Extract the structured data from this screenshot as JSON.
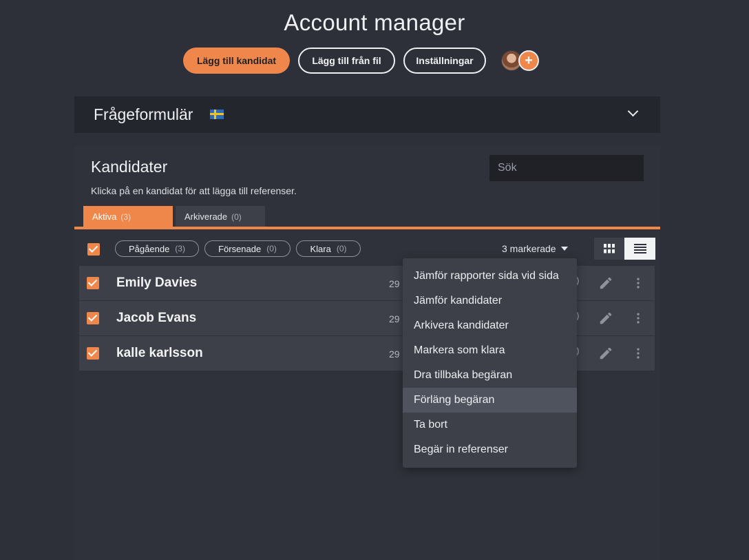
{
  "header": {
    "title": "Account manager",
    "buttons": {
      "add_candidate": "Lägg till kandidat",
      "add_from_file": "Lägg till från fil",
      "settings": "Inställningar"
    },
    "avatar_add_symbol": "+"
  },
  "form_panel": {
    "title": "Frågeformulär",
    "flag": "swedish-flag",
    "expanded": false
  },
  "candidates": {
    "title": "Kandidater",
    "subtitle": "Klicka på en kandidat för att lägga till referenser.",
    "search_placeholder": "Sök",
    "tabs": [
      {
        "label": "Aktiva",
        "count": "(3)",
        "active": true
      },
      {
        "label": "Arkiverade",
        "count": "(0)",
        "active": false
      }
    ],
    "filters": [
      {
        "label": "Pågående",
        "count": "(3)"
      },
      {
        "label": "Försenade",
        "count": "(0)"
      },
      {
        "label": "Klara",
        "count": "(0)"
      }
    ],
    "selected_label": "3 markerade",
    "view_mode": "list",
    "rows": [
      {
        "name": "Emily Davies",
        "date": "29 s",
        "checked": true
      },
      {
        "name": "Jacob Evans",
        "date": "29 s",
        "checked": true
      },
      {
        "name": "kalle karlsson",
        "date": "29 s",
        "checked": true
      }
    ]
  },
  "bulk_menu": {
    "items": [
      "Jämför rapporter sida vid sida",
      "Jämför kandidater",
      "Arkivera kandidater",
      "Markera som klara",
      "Dra tillbaka begäran",
      "Förläng begäran",
      "Ta bort",
      "Begär in referenser"
    ],
    "hovered_index": 5
  },
  "colors": {
    "accent": "#f0874a",
    "background": "#2d3039",
    "panel": "#2f323a",
    "row": "#3d4049"
  }
}
